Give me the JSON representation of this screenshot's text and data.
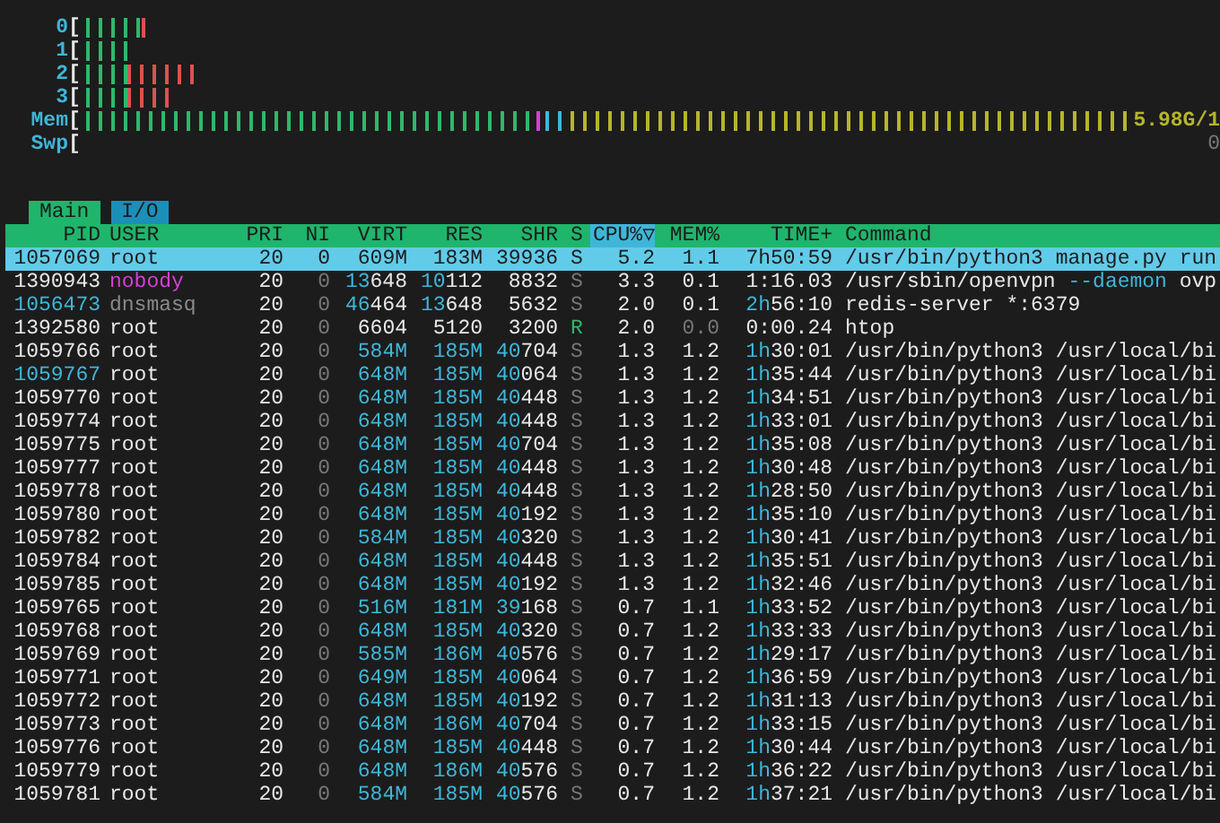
{
  "meters": [
    {
      "label": "0",
      "bracket": "[",
      "segments": [
        {
          "level": 0.049,
          "color": "#2fb86b"
        },
        {
          "level": 0.012,
          "color": "#d9534f"
        }
      ]
    },
    {
      "label": "1",
      "bracket": "[",
      "segments": [
        {
          "level": 0.037,
          "color": "#2fb86b"
        }
      ]
    },
    {
      "label": "2",
      "bracket": "[",
      "segments": [
        {
          "level": 0.037,
          "color": "#2fb86b"
        },
        {
          "level": 0.061,
          "color": "#d9534f"
        }
      ]
    },
    {
      "label": "3",
      "bracket": "[",
      "segments": [
        {
          "level": 0.037,
          "color": "#2fb86b"
        },
        {
          "level": 0.037,
          "color": "#d9534f"
        }
      ]
    },
    {
      "label": "Mem",
      "bracket": "[",
      "segments": [
        {
          "level": 0.43,
          "color": "#2fb86b"
        },
        {
          "level": 0.008,
          "color": "#d63fd6"
        },
        {
          "level": 0.024,
          "color": "#3fb6d8"
        },
        {
          "level": 0.538,
          "color": "#b5b52a"
        }
      ],
      "value": "5.98G/1"
    },
    {
      "label": "Swp",
      "bracket": "[",
      "value": "0"
    }
  ],
  "tabs": [
    {
      "label": "Main",
      "selected": true
    },
    {
      "label": "I/O",
      "selected": false
    }
  ],
  "columns": [
    {
      "label": "PID",
      "sorted": false
    },
    {
      "label": "USER",
      "sorted": false
    },
    {
      "label": "PRI",
      "sorted": false
    },
    {
      "label": "NI",
      "sorted": false
    },
    {
      "label": "VIRT",
      "sorted": false
    },
    {
      "label": "RES",
      "sorted": false
    },
    {
      "label": "SHR",
      "sorted": false
    },
    {
      "label": "S",
      "sorted": false
    },
    {
      "label": "CPU%▽",
      "sorted": true
    },
    {
      "label": "MEM%",
      "sorted": false
    },
    {
      "label": "TIME+",
      "sorted": false
    },
    {
      "label": "Command",
      "sorted": false
    }
  ],
  "rows": [
    {
      "selected": true,
      "pid": "1057069",
      "user": "root",
      "pri": "20",
      "ni": "0",
      "virt": "609M",
      "res": "183M",
      "shr": "39936",
      "s": "S",
      "cpu": "5.2",
      "mem": "1.1",
      "time": "7h50:59",
      "command": [
        {
          "text": "/usr/bin/python3 manage.py run"
        }
      ]
    },
    {
      "selected": false,
      "pid_highlight": false,
      "running": false,
      "mem_dim": false,
      "pid": "1390943",
      "user": {
        "name": "nobody",
        "color": "#d63fd6"
      },
      "pri": "20",
      "ni": "0",
      "virt": "13648",
      "res": "10112",
      "shr": "8832",
      "s": "S",
      "cpu": "3.3",
      "mem": "0.1",
      "time": "1:16.03",
      "command": [
        {
          "text": "/usr/sbin/openvpn ",
          "accent": false
        },
        {
          "text": "--daemon",
          "accent": true
        },
        {
          "text": " ovp",
          "accent": false
        }
      ]
    },
    {
      "selected": false,
      "pid_highlight": true,
      "running": false,
      "mem_dim": false,
      "pid": "1056473",
      "user": {
        "name": "dnsmasq",
        "color": "#8a8a8a"
      },
      "pri": "20",
      "ni": "0",
      "virt": "46464",
      "res": "13648",
      "shr": "5632",
      "s": "S",
      "cpu": "2.0",
      "mem": "0.1",
      "time": "2h56:10",
      "command": [
        {
          "text": "redis-server *:6379",
          "accent": false
        }
      ]
    },
    {
      "selected": false,
      "pid_highlight": false,
      "running": true,
      "mem_dim": true,
      "pid": "1392580",
      "user": "root",
      "pri": "20",
      "ni": "0",
      "virt": "6604",
      "res": "5120",
      "shr": "3200",
      "s": "R",
      "cpu": "2.0",
      "mem": "0.0",
      "time": "0:00.24",
      "command": [
        {
          "text": "htop",
          "accent": false
        }
      ]
    },
    {
      "selected": false,
      "pid_highlight": false,
      "running": false,
      "mem_dim": false,
      "pid": "1059766",
      "user": "root",
      "pri": "20",
      "ni": "0",
      "virt": "584M",
      "res": "185M",
      "shr": "40704",
      "s": "S",
      "cpu": "1.3",
      "mem": "1.2",
      "time": "1h30:01",
      "command": [
        {
          "text": "/usr/bin/python3 /usr/local/bi",
          "accent": false
        }
      ]
    },
    {
      "selected": false,
      "pid_highlight": true,
      "running": false,
      "mem_dim": false,
      "pid": "1059767",
      "user": "root",
      "pri": "20",
      "ni": "0",
      "virt": "648M",
      "res": "185M",
      "shr": "40064",
      "s": "S",
      "cpu": "1.3",
      "mem": "1.2",
      "time": "1h35:44",
      "command": [
        {
          "text": "/usr/bin/python3 /usr/local/bi",
          "accent": false
        }
      ]
    },
    {
      "selected": false,
      "pid_highlight": false,
      "running": false,
      "mem_dim": false,
      "pid": "1059770",
      "user": "root",
      "pri": "20",
      "ni": "0",
      "virt": "648M",
      "res": "185M",
      "shr": "40448",
      "s": "S",
      "cpu": "1.3",
      "mem": "1.2",
      "time": "1h34:51",
      "command": [
        {
          "text": "/usr/bin/python3 /usr/local/bi",
          "accent": false
        }
      ]
    },
    {
      "selected": false,
      "pid_highlight": false,
      "running": false,
      "mem_dim": false,
      "pid": "1059774",
      "user": "root",
      "pri": "20",
      "ni": "0",
      "virt": "648M",
      "res": "185M",
      "shr": "40448",
      "s": "S",
      "cpu": "1.3",
      "mem": "1.2",
      "time": "1h33:01",
      "command": [
        {
          "text": "/usr/bin/python3 /usr/local/bi",
          "accent": false
        }
      ]
    },
    {
      "selected": false,
      "pid_highlight": false,
      "running": false,
      "mem_dim": false,
      "pid": "1059775",
      "user": "root",
      "pri": "20",
      "ni": "0",
      "virt": "648M",
      "res": "185M",
      "shr": "40704",
      "s": "S",
      "cpu": "1.3",
      "mem": "1.2",
      "time": "1h35:08",
      "command": [
        {
          "text": "/usr/bin/python3 /usr/local/bi",
          "accent": false
        }
      ]
    },
    {
      "selected": false,
      "pid_highlight": false,
      "running": false,
      "mem_dim": false,
      "pid": "1059777",
      "user": "root",
      "pri": "20",
      "ni": "0",
      "virt": "648M",
      "res": "185M",
      "shr": "40448",
      "s": "S",
      "cpu": "1.3",
      "mem": "1.2",
      "time": "1h30:48",
      "command": [
        {
          "text": "/usr/bin/python3 /usr/local/bi",
          "accent": false
        }
      ]
    },
    {
      "selected": false,
      "pid_highlight": false,
      "running": false,
      "mem_dim": false,
      "pid": "1059778",
      "user": "root",
      "pri": "20",
      "ni": "0",
      "virt": "648M",
      "res": "185M",
      "shr": "40448",
      "s": "S",
      "cpu": "1.3",
      "mem": "1.2",
      "time": "1h28:50",
      "command": [
        {
          "text": "/usr/bin/python3 /usr/local/bi",
          "accent": false
        }
      ]
    },
    {
      "selected": false,
      "pid_highlight": false,
      "running": false,
      "mem_dim": false,
      "pid": "1059780",
      "user": "root",
      "pri": "20",
      "ni": "0",
      "virt": "648M",
      "res": "185M",
      "shr": "40192",
      "s": "S",
      "cpu": "1.3",
      "mem": "1.2",
      "time": "1h35:10",
      "command": [
        {
          "text": "/usr/bin/python3 /usr/local/bi",
          "accent": false
        }
      ]
    },
    {
      "selected": false,
      "pid_highlight": false,
      "running": false,
      "mem_dim": false,
      "pid": "1059782",
      "user": "root",
      "pri": "20",
      "ni": "0",
      "virt": "584M",
      "res": "185M",
      "shr": "40320",
      "s": "S",
      "cpu": "1.3",
      "mem": "1.2",
      "time": "1h30:41",
      "command": [
        {
          "text": "/usr/bin/python3 /usr/local/bi",
          "accent": false
        }
      ]
    },
    {
      "selected": false,
      "pid_highlight": false,
      "running": false,
      "mem_dim": false,
      "pid": "1059784",
      "user": "root",
      "pri": "20",
      "ni": "0",
      "virt": "648M",
      "res": "185M",
      "shr": "40448",
      "s": "S",
      "cpu": "1.3",
      "mem": "1.2",
      "time": "1h35:51",
      "command": [
        {
          "text": "/usr/bin/python3 /usr/local/bi",
          "accent": false
        }
      ]
    },
    {
      "selected": false,
      "pid_highlight": false,
      "running": false,
      "mem_dim": false,
      "pid": "1059785",
      "user": "root",
      "pri": "20",
      "ni": "0",
      "virt": "648M",
      "res": "185M",
      "shr": "40192",
      "s": "S",
      "cpu": "1.3",
      "mem": "1.2",
      "time": "1h32:46",
      "command": [
        {
          "text": "/usr/bin/python3 /usr/local/bi",
          "accent": false
        }
      ]
    },
    {
      "selected": false,
      "pid_highlight": false,
      "running": false,
      "mem_dim": false,
      "pid": "1059765",
      "user": "root",
      "pri": "20",
      "ni": "0",
      "virt": "516M",
      "res": "181M",
      "shr": "39168",
      "s": "S",
      "cpu": "0.7",
      "mem": "1.1",
      "time": "1h33:52",
      "command": [
        {
          "text": "/usr/bin/python3 /usr/local/bi",
          "accent": false
        }
      ]
    },
    {
      "selected": false,
      "pid_highlight": false,
      "running": false,
      "mem_dim": false,
      "pid": "1059768",
      "user": "root",
      "pri": "20",
      "ni": "0",
      "virt": "648M",
      "res": "185M",
      "shr": "40320",
      "s": "S",
      "cpu": "0.7",
      "mem": "1.2",
      "time": "1h33:33",
      "command": [
        {
          "text": "/usr/bin/python3 /usr/local/bi",
          "accent": false
        }
      ]
    },
    {
      "selected": false,
      "pid_highlight": false,
      "running": false,
      "mem_dim": false,
      "pid": "1059769",
      "user": "root",
      "pri": "20",
      "ni": "0",
      "virt": "585M",
      "res": "186M",
      "shr": "40576",
      "s": "S",
      "cpu": "0.7",
      "mem": "1.2",
      "time": "1h29:17",
      "command": [
        {
          "text": "/usr/bin/python3 /usr/local/bi",
          "accent": false
        }
      ]
    },
    {
      "selected": false,
      "pid_highlight": false,
      "running": false,
      "mem_dim": false,
      "pid": "1059771",
      "user": "root",
      "pri": "20",
      "ni": "0",
      "virt": "649M",
      "res": "185M",
      "shr": "40064",
      "s": "S",
      "cpu": "0.7",
      "mem": "1.2",
      "time": "1h36:59",
      "command": [
        {
          "text": "/usr/bin/python3 /usr/local/bi",
          "accent": false
        }
      ]
    },
    {
      "selected": false,
      "pid_highlight": false,
      "running": false,
      "mem_dim": false,
      "pid": "1059772",
      "user": "root",
      "pri": "20",
      "ni": "0",
      "virt": "648M",
      "res": "185M",
      "shr": "40192",
      "s": "S",
      "cpu": "0.7",
      "mem": "1.2",
      "time": "1h31:13",
      "command": [
        {
          "text": "/usr/bin/python3 /usr/local/bi",
          "accent": false
        }
      ]
    },
    {
      "selected": false,
      "pid_highlight": false,
      "running": false,
      "mem_dim": false,
      "pid": "1059773",
      "user": "root",
      "pri": "20",
      "ni": "0",
      "virt": "648M",
      "res": "186M",
      "shr": "40704",
      "s": "S",
      "cpu": "0.7",
      "mem": "1.2",
      "time": "1h33:15",
      "command": [
        {
          "text": "/usr/bin/python3 /usr/local/bi",
          "accent": false
        }
      ]
    },
    {
      "selected": false,
      "pid_highlight": false,
      "running": false,
      "mem_dim": false,
      "pid": "1059776",
      "user": "root",
      "pri": "20",
      "ni": "0",
      "virt": "648M",
      "res": "185M",
      "shr": "40448",
      "s": "S",
      "cpu": "0.7",
      "mem": "1.2",
      "time": "1h30:44",
      "command": [
        {
          "text": "/usr/bin/python3 /usr/local/bi",
          "accent": false
        }
      ]
    },
    {
      "selected": false,
      "pid_highlight": false,
      "running": false,
      "mem_dim": false,
      "pid": "1059779",
      "user": "root",
      "pri": "20",
      "ni": "0",
      "virt": "648M",
      "res": "186M",
      "shr": "40576",
      "s": "S",
      "cpu": "0.7",
      "mem": "1.2",
      "time": "1h36:22",
      "command": [
        {
          "text": "/usr/bin/python3 /usr/local/bi",
          "accent": false
        }
      ]
    },
    {
      "selected": false,
      "pid_highlight": false,
      "running": false,
      "mem_dim": false,
      "pid": "1059781",
      "user": "root",
      "pri": "20",
      "ni": "0",
      "virt": "584M",
      "res": "185M",
      "shr": "40576",
      "s": "S",
      "cpu": "0.7",
      "mem": "1.2",
      "time": "1h37:21",
      "command": [
        {
          "text": "/usr/bin/python3 /usr/local/bi",
          "accent": false
        }
      ]
    }
  ]
}
